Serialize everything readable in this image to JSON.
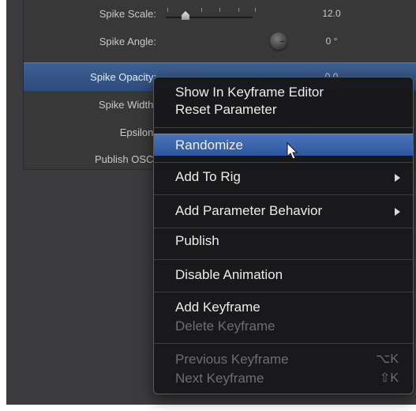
{
  "params": [
    {
      "label": "Spike Scale:",
      "value": "12.0"
    },
    {
      "label": "Spike Angle:",
      "value": "0 °"
    },
    {
      "label": "Spike Opacity:",
      "value": "0.0"
    },
    {
      "label": "Spike Width:",
      "value": ""
    },
    {
      "label": "Epsilon:",
      "value": ""
    },
    {
      "label": "Publish OSC:",
      "value": ""
    }
  ],
  "menu": {
    "show_in_keyframe_editor": "Show In Keyframe Editor",
    "reset_parameter": "Reset Parameter",
    "randomize": "Randomize",
    "add_to_rig": "Add To Rig",
    "add_parameter_behavior": "Add Parameter Behavior",
    "publish": "Publish",
    "disable_animation": "Disable Animation",
    "add_keyframe": "Add Keyframe",
    "delete_keyframe": "Delete Keyframe",
    "previous_keyframe": "Previous Keyframe",
    "previous_keyframe_shortcut": "⌥K",
    "next_keyframe": "Next Keyframe",
    "next_keyframe_shortcut": "⇧K"
  },
  "colors": {
    "menu_highlight": "#3b63ad",
    "selected_row": "#365686",
    "panel_bg": "#3b3b3d"
  }
}
